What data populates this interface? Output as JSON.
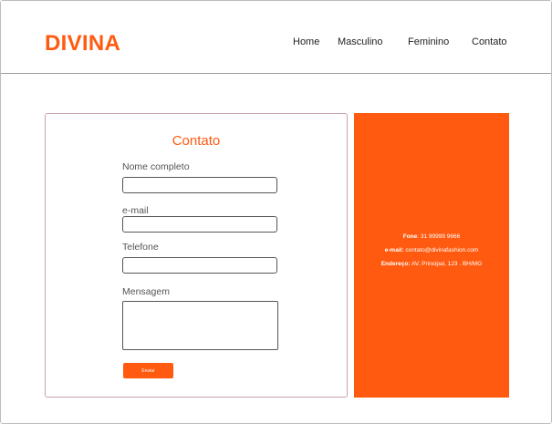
{
  "header": {
    "logo": "DIVINA",
    "nav": [
      {
        "label": "Home"
      },
      {
        "label": "Masculino"
      },
      {
        "label": "Feminino"
      },
      {
        "label": "Contato"
      }
    ]
  },
  "form": {
    "title": "Contato",
    "fields": {
      "name_label": "Nome completo",
      "name_value": "",
      "email_label": "e-mail",
      "email_value": "",
      "phone_label": "Telefone",
      "phone_value": "",
      "message_label": "Mensagem",
      "message_value": ""
    },
    "submit_label": "Enviar"
  },
  "contact_info": {
    "phone_label": "Fone",
    "phone_value": ": 31 99999 9666",
    "email_label": "e-mail:",
    "email_value": " contato@divinafashion.com",
    "address_label": "Endereço:",
    "address_value": " AV. Principal, 123 . BH/MG"
  },
  "colors": {
    "accent": "#ff5a0f",
    "form_border": "#c9a2ad",
    "divider": "#9e9e9e"
  }
}
